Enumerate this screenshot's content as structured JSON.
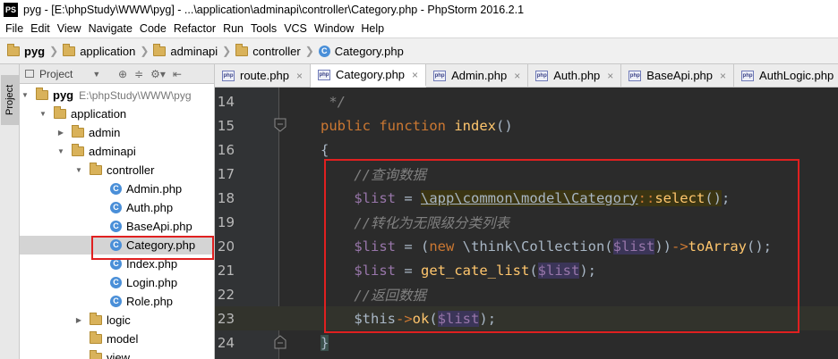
{
  "window": {
    "app_icon": "PS",
    "title": "pyg - [E:\\phpStudy\\WWW\\pyg] - ...\\application\\adminapi\\controller\\Category.php - PhpStorm 2016.2.1"
  },
  "menu": [
    "File",
    "Edit",
    "View",
    "Navigate",
    "Code",
    "Refactor",
    "Run",
    "Tools",
    "VCS",
    "Window",
    "Help"
  ],
  "breadcrumb": [
    "pyg",
    "application",
    "adminapi",
    "controller",
    "Category.php"
  ],
  "tool_stripe": {
    "project_tab": "Project"
  },
  "project_panel": {
    "title": "Project",
    "tree": [
      {
        "label": "pyg",
        "path": "E:\\phpStudy\\WWW\\pyg",
        "type": "folder",
        "depth": 0,
        "expanded": true
      },
      {
        "label": "application",
        "type": "folder",
        "depth": 1,
        "expanded": true
      },
      {
        "label": "admin",
        "type": "folder",
        "depth": 2,
        "expanded": false
      },
      {
        "label": "adminapi",
        "type": "folder",
        "depth": 2,
        "expanded": true
      },
      {
        "label": "controller",
        "type": "folder",
        "depth": 3,
        "expanded": true
      },
      {
        "label": "Admin.php",
        "type": "class",
        "depth": 4
      },
      {
        "label": "Auth.php",
        "type": "class",
        "depth": 4
      },
      {
        "label": "BaseApi.php",
        "type": "class",
        "depth": 4
      },
      {
        "label": "Category.php",
        "type": "class",
        "depth": 4,
        "selected": true
      },
      {
        "label": "Index.php",
        "type": "class",
        "depth": 4
      },
      {
        "label": "Login.php",
        "type": "class",
        "depth": 4
      },
      {
        "label": "Role.php",
        "type": "class",
        "depth": 4
      },
      {
        "label": "logic",
        "type": "folder",
        "depth": 3,
        "expanded": false
      },
      {
        "label": "model",
        "type": "folder",
        "depth": 3
      },
      {
        "label": "view",
        "type": "folder",
        "depth": 3
      }
    ]
  },
  "tabs": [
    {
      "label": "route.php",
      "active": false
    },
    {
      "label": "Category.php",
      "active": true
    },
    {
      "label": "Admin.php",
      "active": false
    },
    {
      "label": "Auth.php",
      "active": false
    },
    {
      "label": "BaseApi.php",
      "active": false
    },
    {
      "label": "AuthLogic.php",
      "active": false
    }
  ],
  "editor": {
    "lines": [
      {
        "n": "14",
        "text": " */"
      },
      {
        "n": "15",
        "text": "public function index()"
      },
      {
        "n": "16",
        "text": "{"
      },
      {
        "n": "17",
        "text": "    //查询数据"
      },
      {
        "n": "18",
        "text": "    $list = \\app\\common\\model\\Category::select();"
      },
      {
        "n": "19",
        "text": "    //转化为无限级分类列表"
      },
      {
        "n": "20",
        "text": "    $list = (new \\think\\Collection($list))->toArray();"
      },
      {
        "n": "21",
        "text": "    $list = get_cate_list($list);"
      },
      {
        "n": "22",
        "text": "    //返回数据"
      },
      {
        "n": "23",
        "text": "    $this->ok($list);"
      },
      {
        "n": "24",
        "text": "}"
      }
    ],
    "current_line": "23"
  }
}
